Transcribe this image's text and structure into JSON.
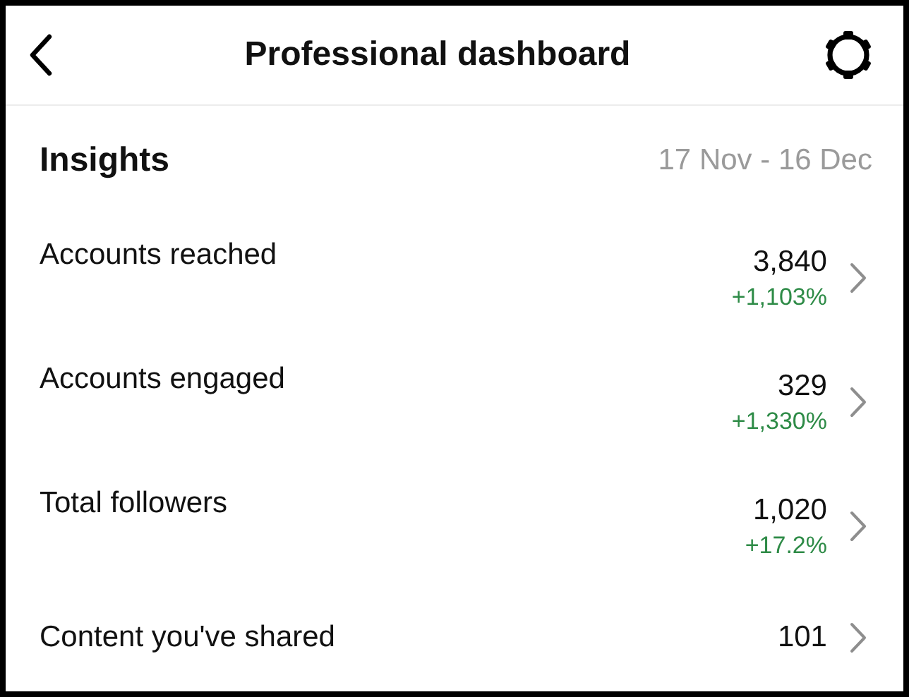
{
  "header": {
    "title": "Professional dashboard"
  },
  "insights": {
    "title": "Insights",
    "date_range": "17 Nov - 16 Dec"
  },
  "metrics": [
    {
      "label": "Accounts reached",
      "value": "3,840",
      "change": "+1,103%"
    },
    {
      "label": "Accounts engaged",
      "value": "329",
      "change": "+1,330%"
    },
    {
      "label": "Total followers",
      "value": "1,020",
      "change": "+17.2%"
    },
    {
      "label": "Content you've shared",
      "value": "101"
    }
  ]
}
